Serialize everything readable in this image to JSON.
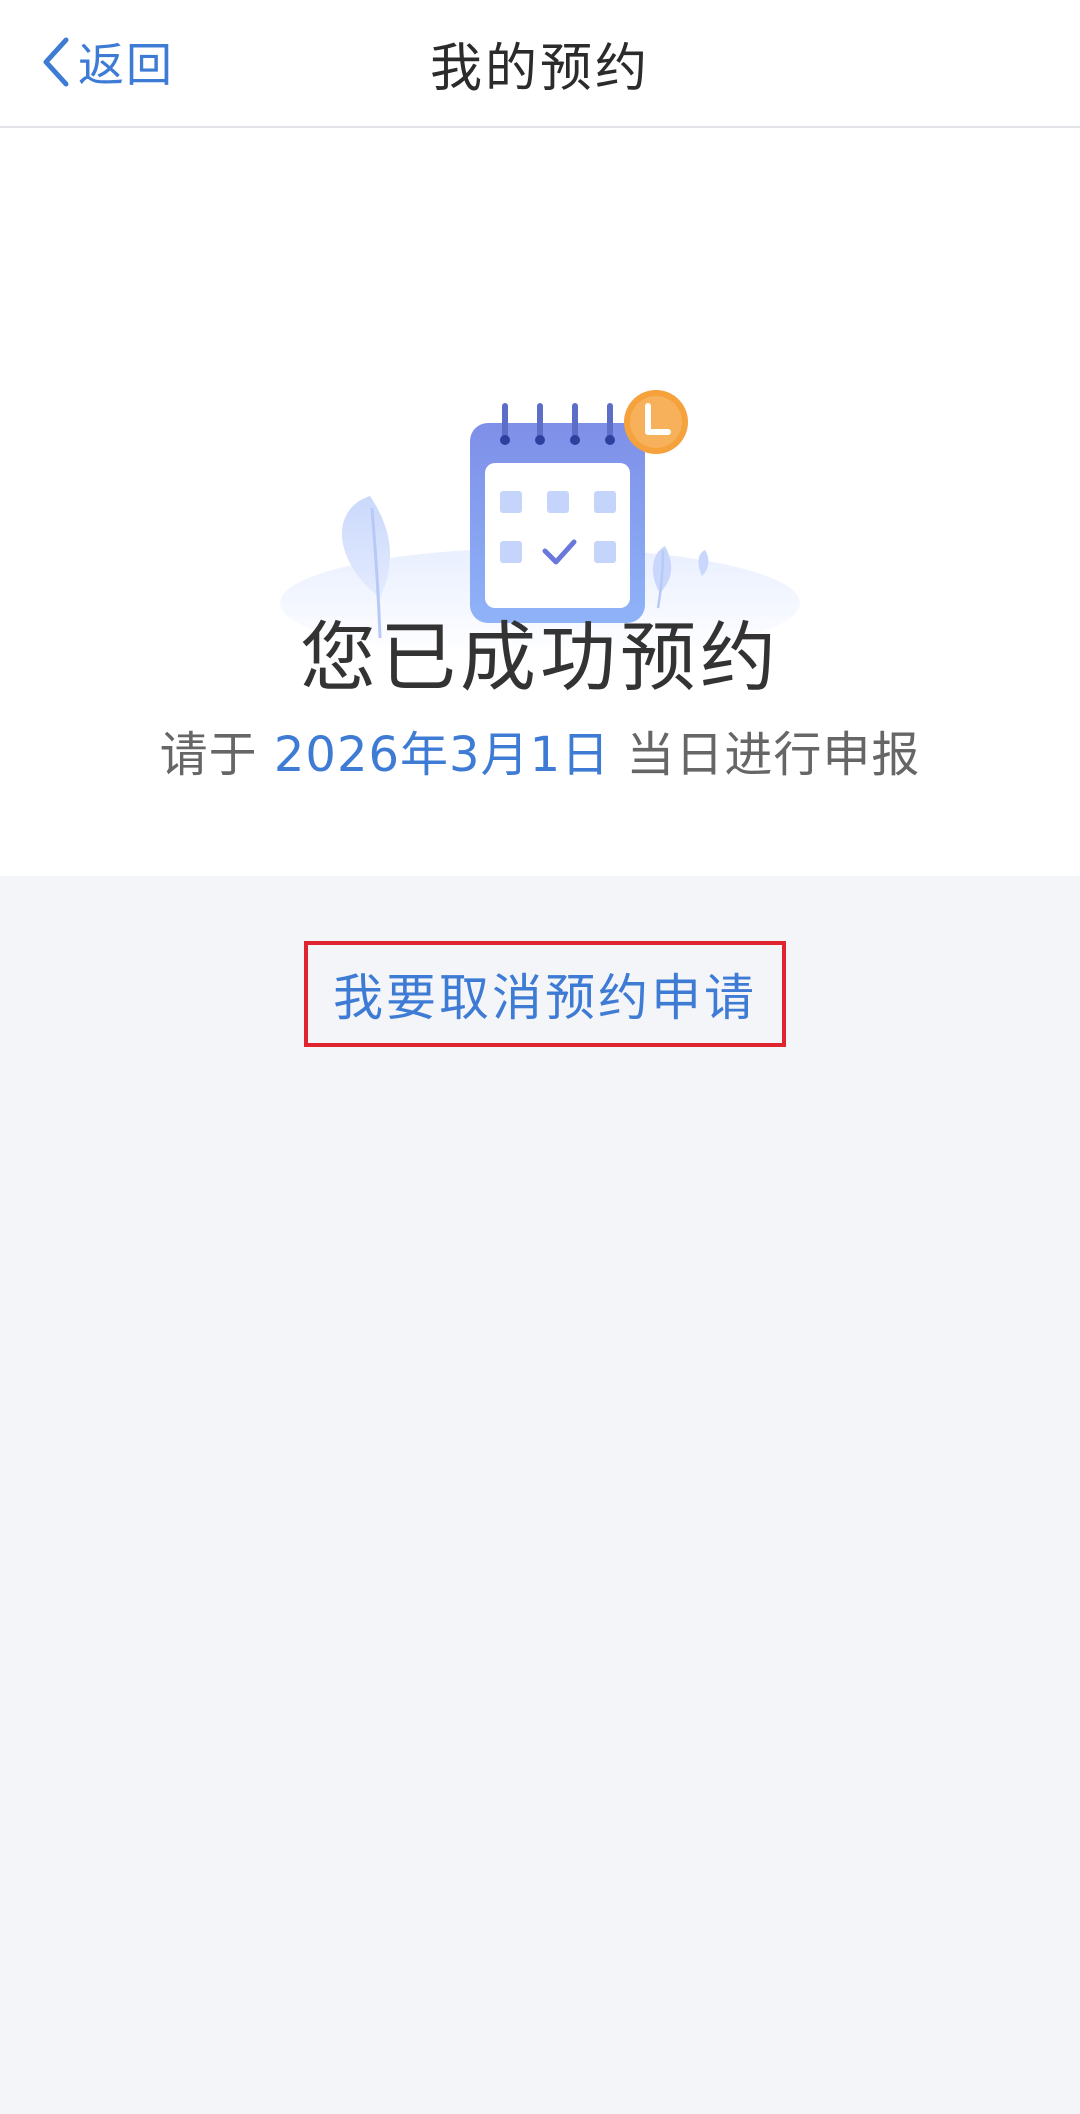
{
  "nav": {
    "back_label": "返回",
    "title": "我的预约"
  },
  "result": {
    "title": "您已成功预约",
    "sub_prefix": "请于 ",
    "date": "2026年3月1日",
    "sub_suffix": " 当日进行申报"
  },
  "actions": {
    "cancel_label": "我要取消预约申请"
  },
  "colors": {
    "accent": "#3e7bd4",
    "highlight_border": "#e0242f",
    "clock_badge": "#f5a13c",
    "page_bg": "#f4f5f9"
  },
  "icons": {
    "back": "chevron-left-icon",
    "illustration": "calendar-check-icon",
    "clock": "clock-icon"
  }
}
